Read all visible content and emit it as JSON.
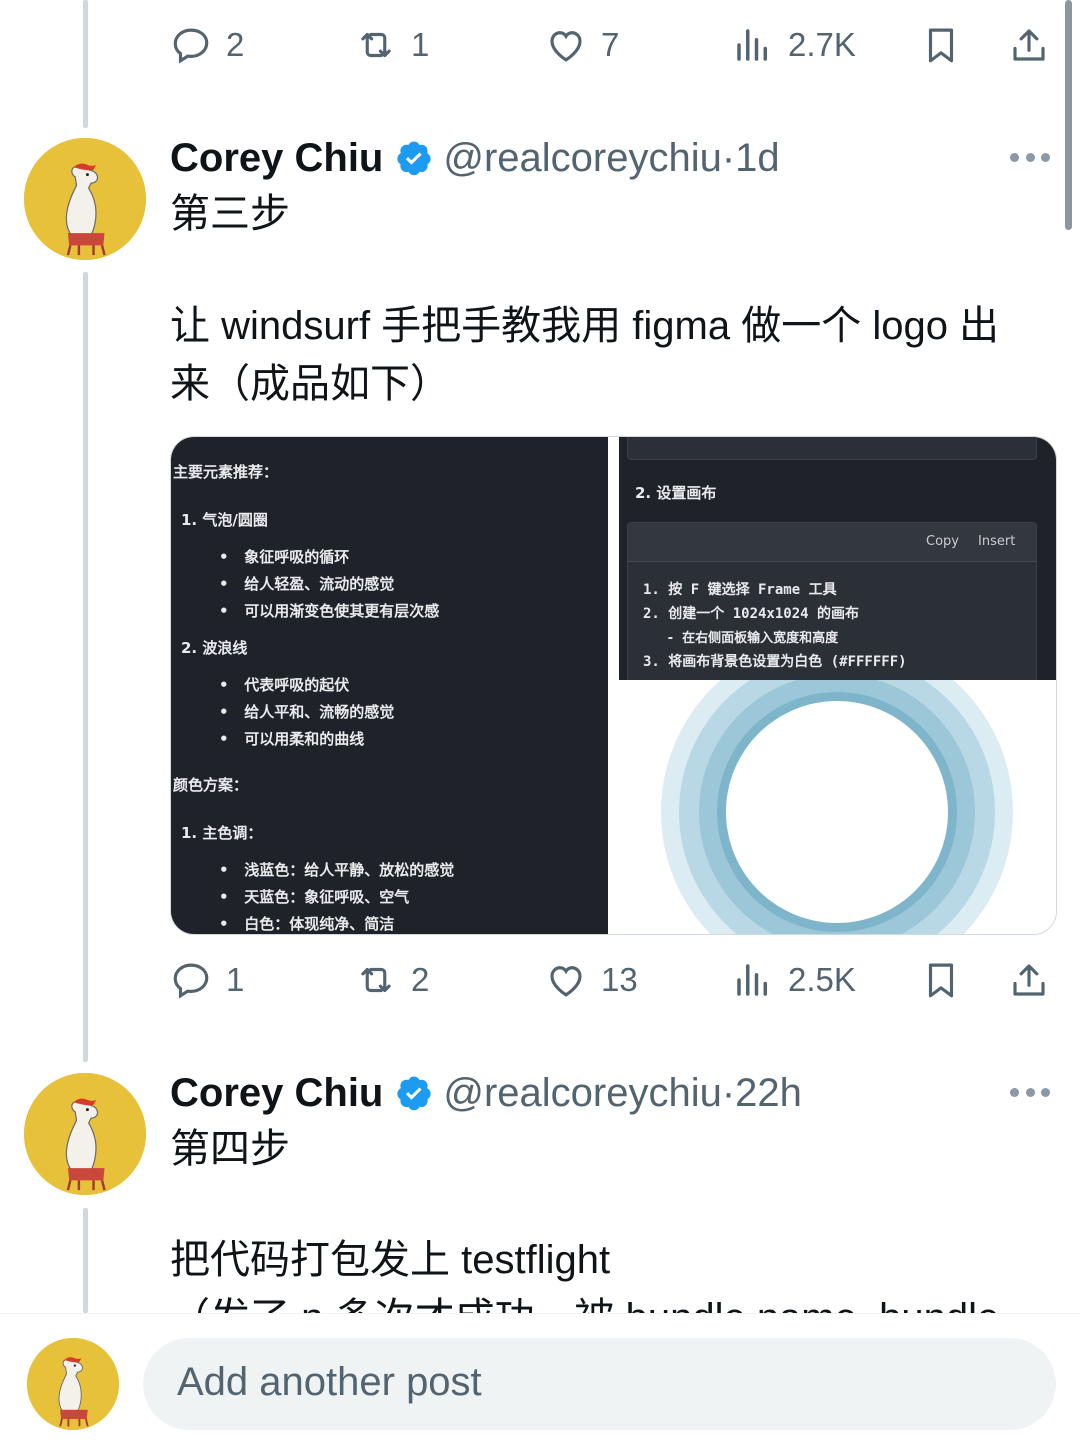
{
  "colors": {
    "accent": "#1d9bf0",
    "muted": "#536471",
    "thread_line": "#cfd9de",
    "avatar_bg": "#e8c13a"
  },
  "post_prev": {
    "actions": {
      "replies": "2",
      "reposts": "1",
      "likes": "7",
      "views": "2.7K"
    }
  },
  "post_3": {
    "author": {
      "name": "Corey Chiu",
      "handle": "@realcoreychiu",
      "time": "·1d"
    },
    "lines": [
      "第三步",
      "让 windsurf 手把手教我用 figma 做一个 logo 出",
      "来（成品如下）"
    ],
    "media": {
      "left_panel": {
        "heading_main": "主要元素推荐：",
        "item1": "1. 气泡/圆圈",
        "item1_bullets": [
          "象征呼吸的循环",
          "给人轻盈、流动的感觉",
          "可以用渐变色使其更有层次感"
        ],
        "item2": "2. 波浪线",
        "item2_bullets": [
          "代表呼吸的起伏",
          "给人平和、流畅的感觉",
          "可以用柔和的曲线"
        ],
        "heading_color": "颜色方案：",
        "item3": "1. 主色调：",
        "item3_bullets": [
          "浅蓝色：给人平静、放松的感觉",
          "天蓝色：象征呼吸、空气",
          "白色：体现纯净、简洁"
        ]
      },
      "right_panel": {
        "step": "2. 设置画布",
        "copy_label": "Copy",
        "insert_label": "Insert",
        "code_lines": [
          "1. 按 F 键选择 Frame 工具",
          "2. 创建一个 1024x1024 的画布",
          "   - 在右侧面板输入宽度和高度",
          "3. 将画布背景色设置为白色 (#FFFFFF)"
        ]
      }
    },
    "actions": {
      "replies": "1",
      "reposts": "2",
      "likes": "13",
      "views": "2.5K"
    }
  },
  "post_4": {
    "author": {
      "name": "Corey Chiu",
      "handle": "@realcoreychiu",
      "time": "·22h"
    },
    "lines": [
      "第四步",
      "把代码打包发上 testflight",
      "（发了 n 多次才成功，被 bundle name, bundle"
    ]
  },
  "compose": {
    "placeholder": "Add another post"
  }
}
